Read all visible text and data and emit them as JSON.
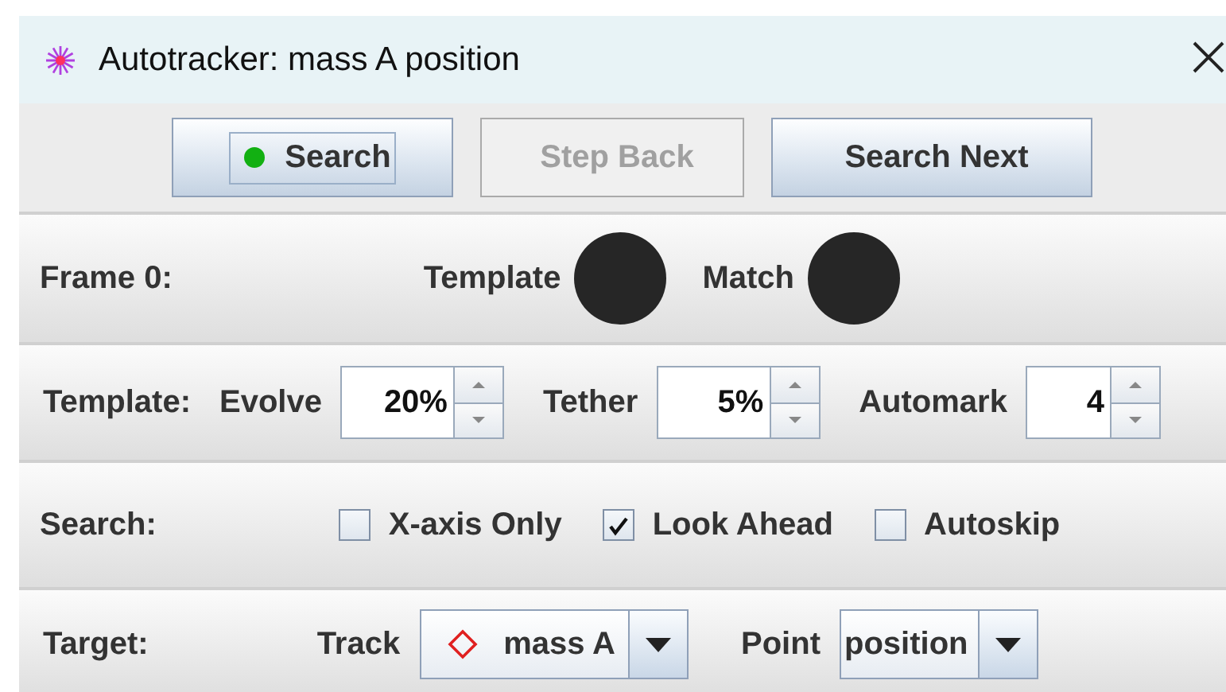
{
  "window": {
    "title": "Autotracker: mass A position"
  },
  "buttons": [
    {
      "label": "Search",
      "disabled": false,
      "focused": true
    },
    {
      "label": "Step Back",
      "disabled": true,
      "focused": false
    },
    {
      "label": "Search Next",
      "disabled": false,
      "focused": false
    }
  ],
  "frame_row": {
    "label": "Frame 0:",
    "template_label": "Template",
    "match_label": "Match"
  },
  "template_row": {
    "label": "Template:",
    "spinners": [
      {
        "label": "Evolve",
        "value": "20%"
      },
      {
        "label": "Tether",
        "value": "5%"
      },
      {
        "label": "Automark",
        "value": "4"
      }
    ]
  },
  "search_row": {
    "label": "Search:",
    "checkboxes": [
      {
        "label": "X-axis Only",
        "checked": false
      },
      {
        "label": "Look Ahead",
        "checked": true
      },
      {
        "label": "Autoskip",
        "checked": false
      }
    ]
  },
  "target_row": {
    "label": "Target:",
    "dropdowns": [
      {
        "label": "Track",
        "value": "mass A",
        "kind": "track"
      },
      {
        "label": "Point",
        "value": "position",
        "kind": "plain"
      }
    ]
  }
}
